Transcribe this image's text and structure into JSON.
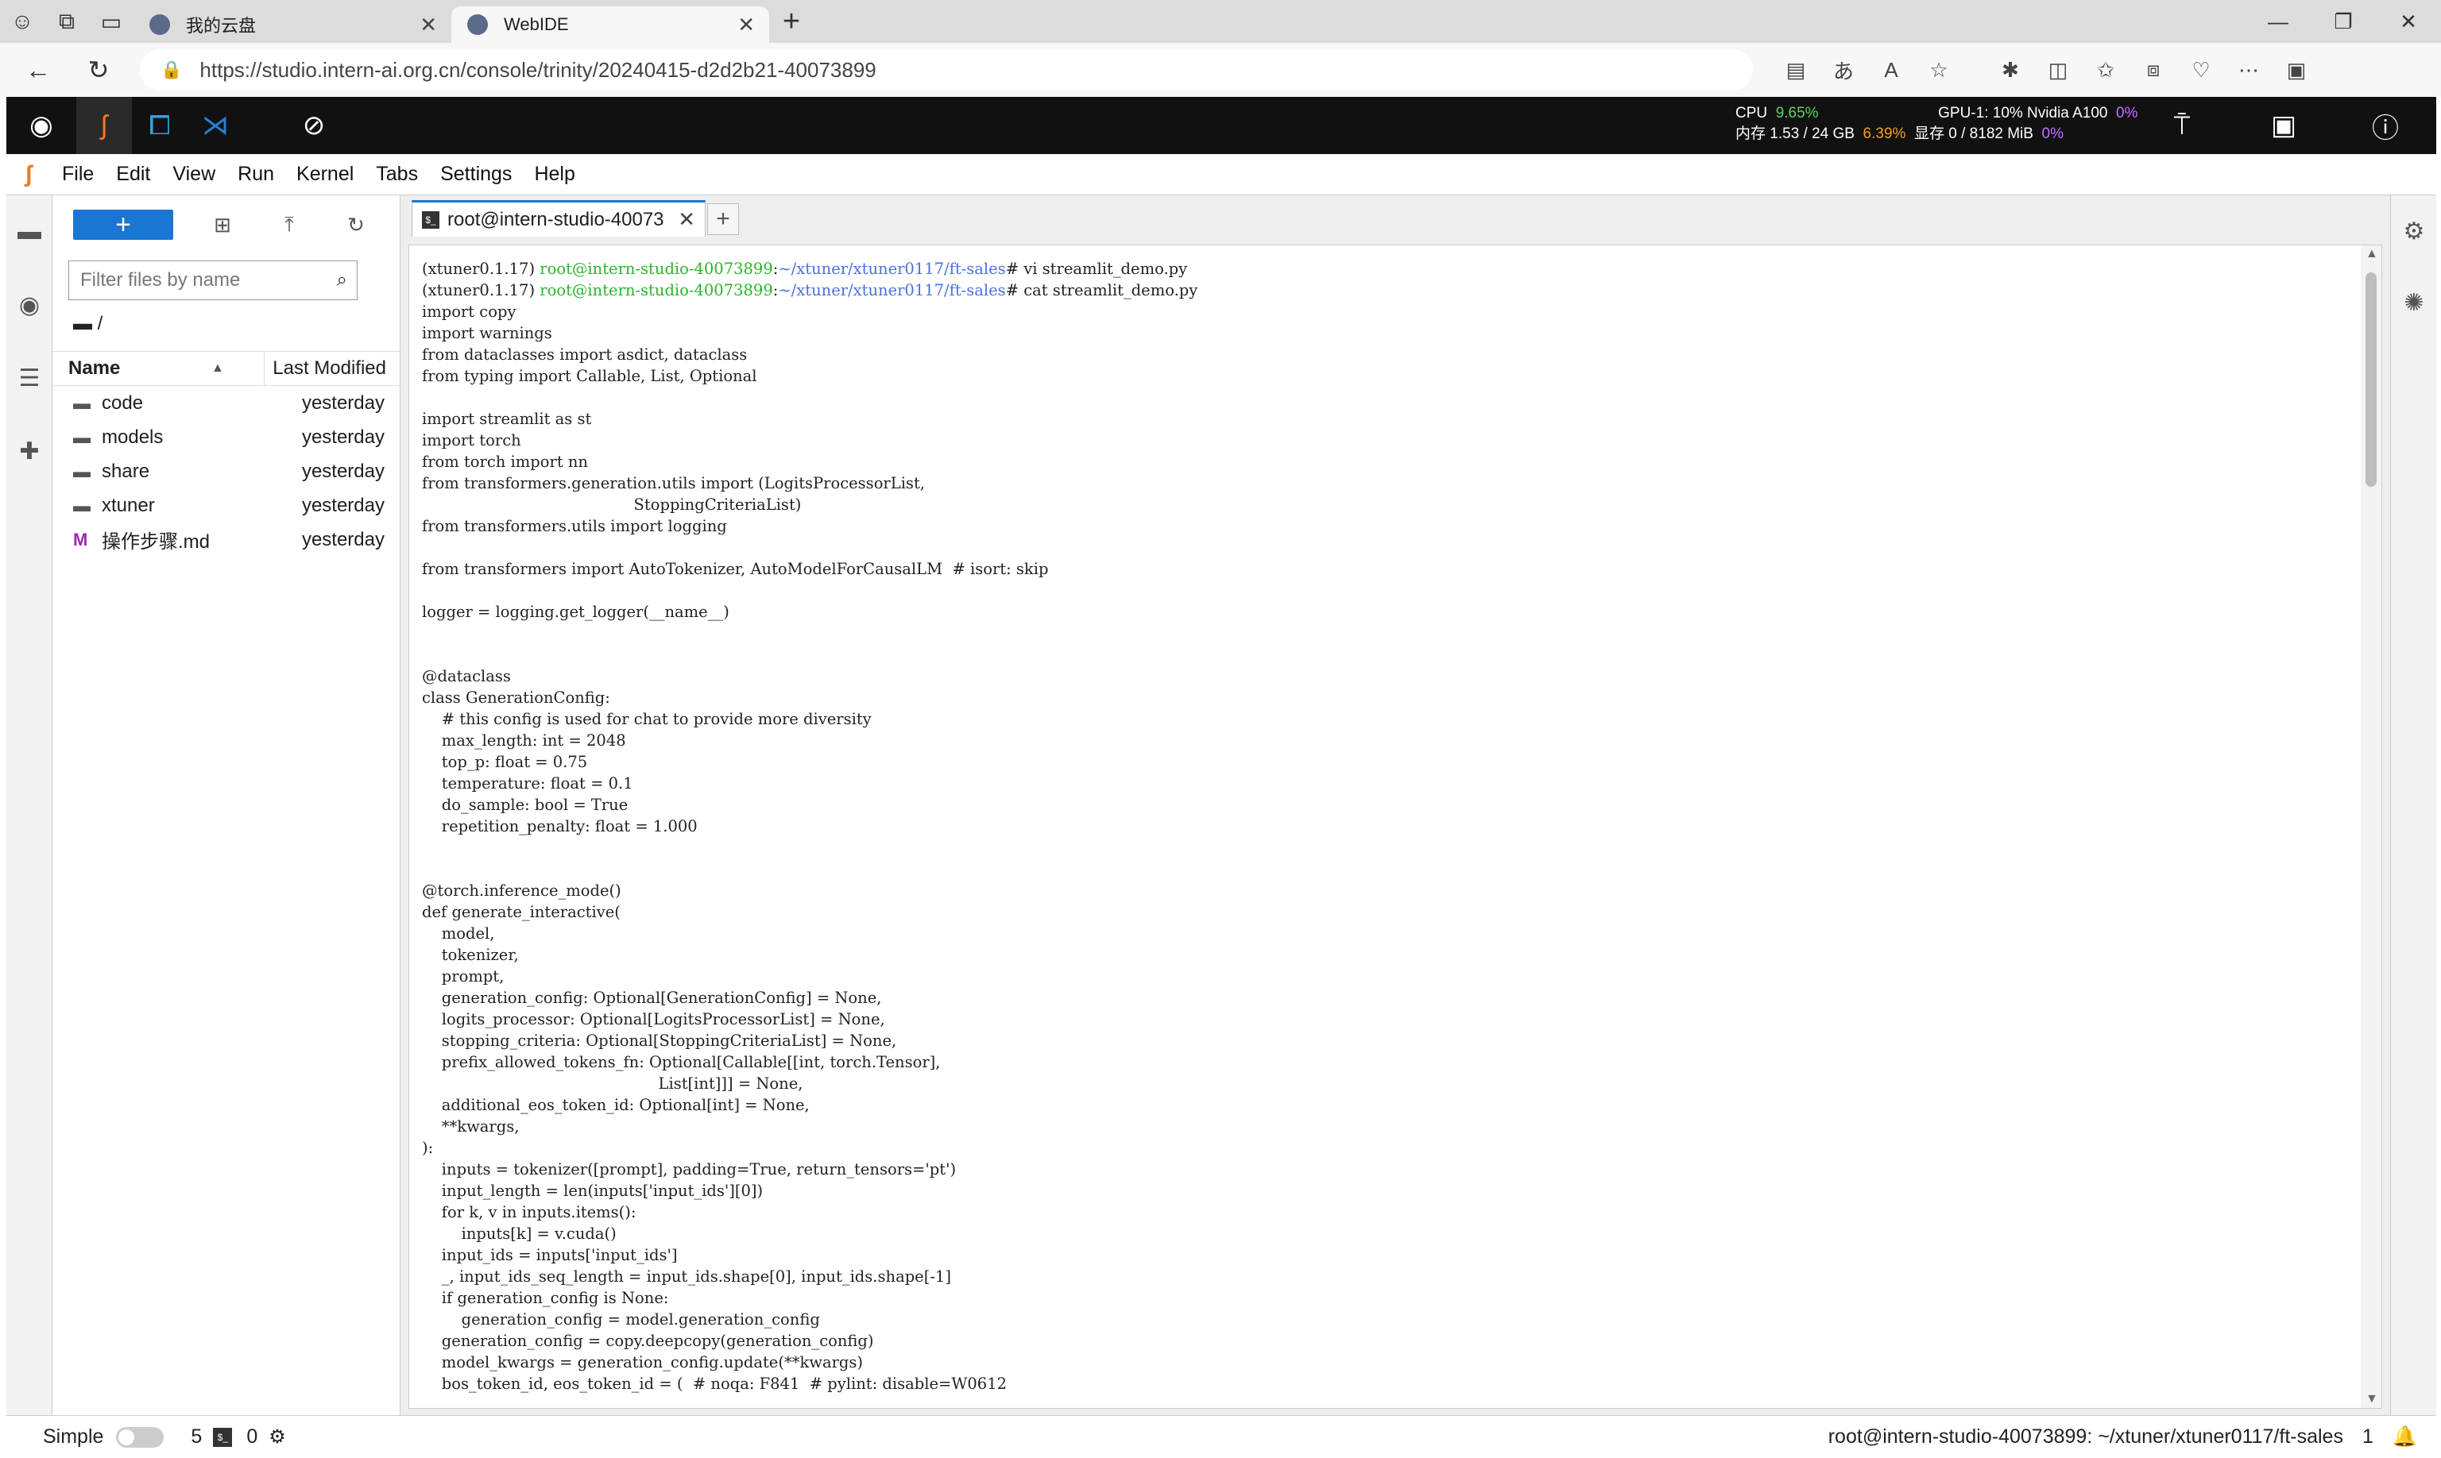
{
  "browser": {
    "tabs": [
      {
        "title": "我的云盘",
        "active": false
      },
      {
        "title": "WebIDE",
        "active": true
      }
    ],
    "url": "https://studio.intern-ai.org.cn/console/trinity/20240415-d2d2b21-40073899"
  },
  "header": {
    "cpu_label": "CPU",
    "cpu_value": "9.65%",
    "mem_label": "内存",
    "mem_value": "1.53 / 24 GB",
    "mem_pct": "6.39%",
    "gpu_label": "GPU-1: 10% Nvidia A100",
    "gpu_pct": "0%",
    "vram_label": "显存",
    "vram_value": "0 / 8182 MiB",
    "vram_pct": "0%"
  },
  "menubar": {
    "items": [
      "File",
      "Edit",
      "View",
      "Run",
      "Kernel",
      "Tabs",
      "Settings",
      "Help"
    ]
  },
  "filebrowser": {
    "filter_placeholder": "Filter files by name",
    "breadcrumb": "/",
    "col_name": "Name",
    "col_modified": "Last Modified",
    "files": [
      {
        "name": "code",
        "modified": "yesterday",
        "type": "folder"
      },
      {
        "name": "models",
        "modified": "yesterday",
        "type": "folder"
      },
      {
        "name": "share",
        "modified": "yesterday",
        "type": "folder"
      },
      {
        "name": "xtuner",
        "modified": "yesterday",
        "type": "folder"
      },
      {
        "name": "操作步骤.md",
        "modified": "yesterday",
        "type": "markdown"
      }
    ]
  },
  "editor": {
    "tab_title": "root@intern-studio-40073",
    "prompt_env": "(xtuner0.1.17)",
    "prompt_user": "root@intern-studio-40073899",
    "prompt_path": "~/xtuner/xtuner0117/ft-sales",
    "cmd1": "# vi streamlit_demo.py",
    "cmd2": "# cat streamlit_demo.py",
    "code": "import copy\nimport warnings\nfrom dataclasses import asdict, dataclass\nfrom typing import Callable, List, Optional\n\nimport streamlit as st\nimport torch\nfrom torch import nn\nfrom transformers.generation.utils import (LogitsProcessorList,\n                                           StoppingCriteriaList)\nfrom transformers.utils import logging\n\nfrom transformers import AutoTokenizer, AutoModelForCausalLM  # isort: skip\n\nlogger = logging.get_logger(__name__)\n\n\n@dataclass\nclass GenerationConfig:\n    # this config is used for chat to provide more diversity\n    max_length: int = 2048\n    top_p: float = 0.75\n    temperature: float = 0.1\n    do_sample: bool = True\n    repetition_penalty: float = 1.000\n\n\n@torch.inference_mode()\ndef generate_interactive(\n    model,\n    tokenizer,\n    prompt,\n    generation_config: Optional[GenerationConfig] = None,\n    logits_processor: Optional[LogitsProcessorList] = None,\n    stopping_criteria: Optional[StoppingCriteriaList] = None,\n    prefix_allowed_tokens_fn: Optional[Callable[[int, torch.Tensor],\n                                                List[int]]] = None,\n    additional_eos_token_id: Optional[int] = None,\n    **kwargs,\n):\n    inputs = tokenizer([prompt], padding=True, return_tensors='pt')\n    input_length = len(inputs['input_ids'][0])\n    for k, v in inputs.items():\n        inputs[k] = v.cuda()\n    input_ids = inputs['input_ids']\n    _, input_ids_seq_length = input_ids.shape[0], input_ids.shape[-1]\n    if generation_config is None:\n        generation_config = model.generation_config\n    generation_config = copy.deepcopy(generation_config)\n    model_kwargs = generation_config.update(**kwargs)\n    bos_token_id, eos_token_id = (  # noqa: F841  # pylint: disable=W0612"
  },
  "statusbar": {
    "mode_label": "Simple",
    "kernels_count": "5",
    "terminals_count": "0",
    "path": "root@intern-studio-40073899: ~/xtuner/xtuner0117/ft-sales",
    "notif_count": "1"
  },
  "colors": {
    "accent": "#1976d2",
    "prompt_green": "#2bb52b",
    "prompt_blue": "#4a72e0",
    "jupyter_orange": "#f37726"
  }
}
